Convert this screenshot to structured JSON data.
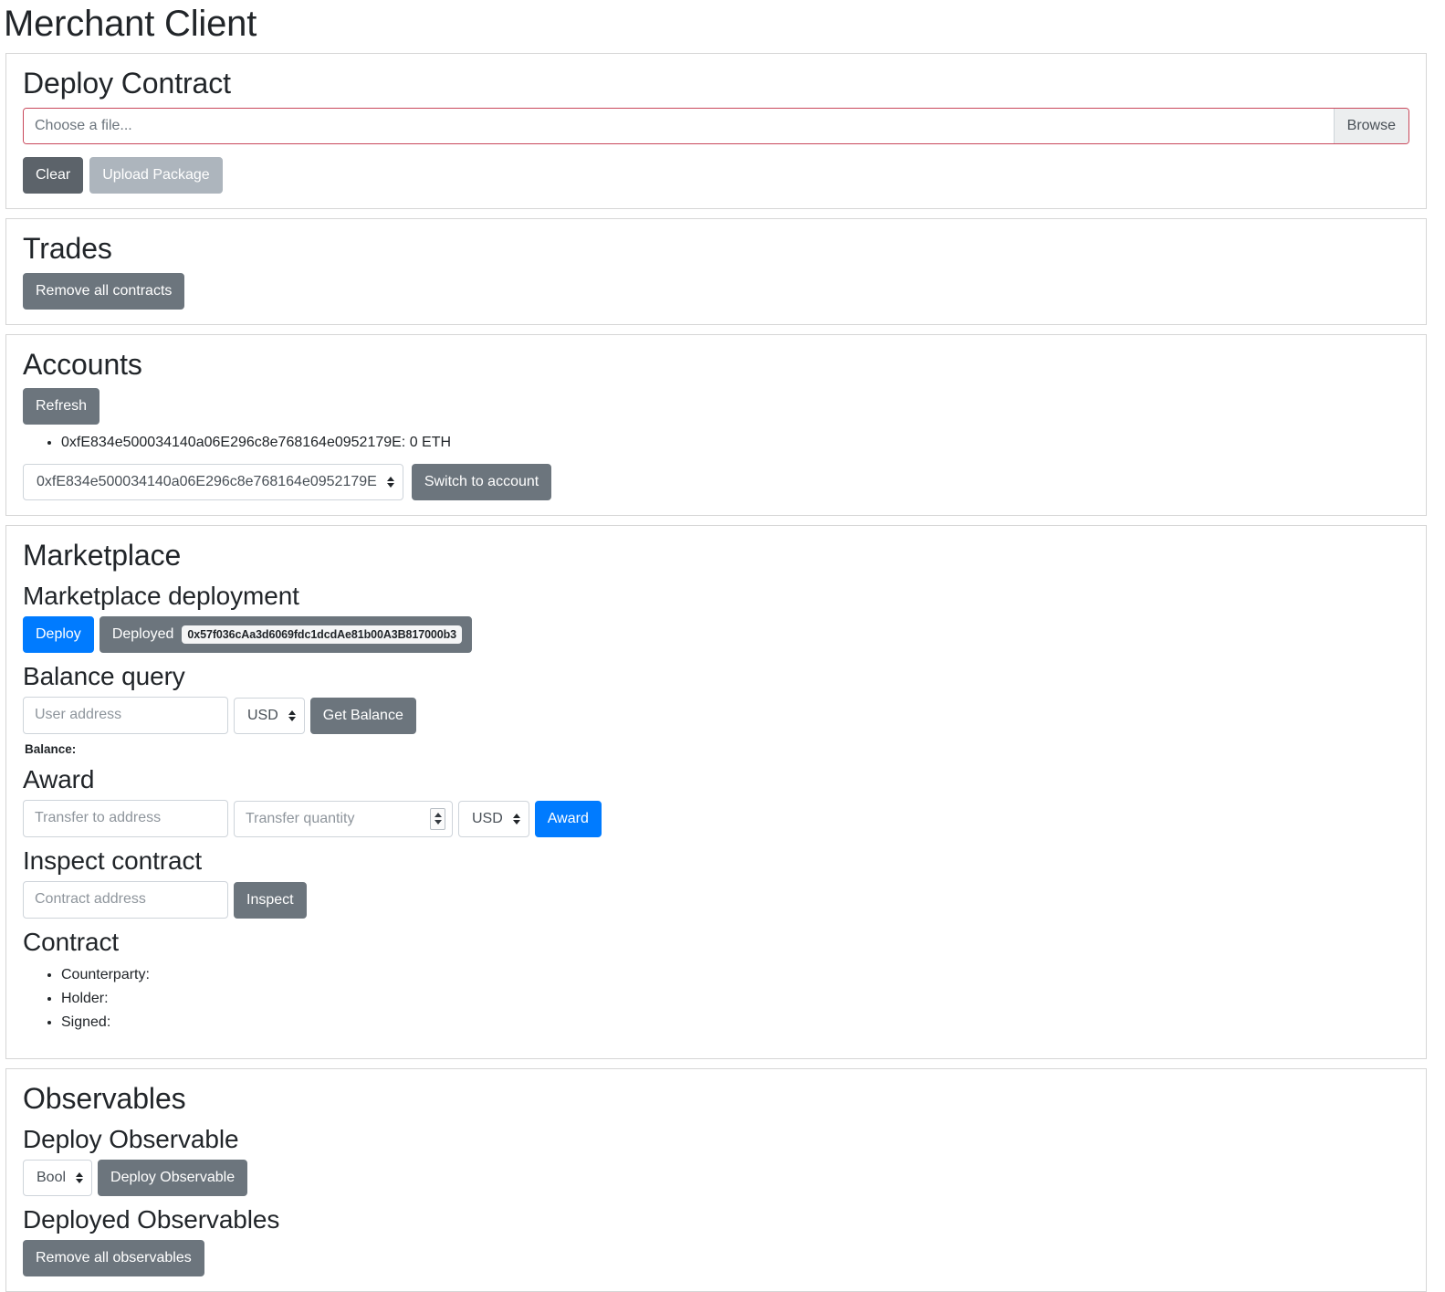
{
  "app": {
    "title": "Merchant Client"
  },
  "deploy_contract": {
    "heading": "Deploy Contract",
    "file_input": {
      "placeholder": "Choose a file...",
      "browse_label": "Browse",
      "border_color": "#c9485b"
    },
    "clear_label": "Clear",
    "upload_label": "Upload Package"
  },
  "trades": {
    "heading": "Trades",
    "remove_all_label": "Remove all contracts"
  },
  "accounts": {
    "heading": "Accounts",
    "refresh_label": "Refresh",
    "items": [
      "0xfE834e500034140a06E296c8e768164e0952179E: 0 ETH"
    ],
    "account_select": {
      "selected": "0xfE834e500034140a06E296c8e768164e0952179E",
      "options": [
        "0xfE834e500034140a06E296c8e768164e0952179E"
      ]
    },
    "switch_label": "Switch to account"
  },
  "marketplace": {
    "heading": "Marketplace",
    "deployment": {
      "heading": "Marketplace deployment",
      "deploy_label": "Deploy",
      "deployed_label": "Deployed",
      "deployed_address": "0x57f036cAa3d6069fdc1dcdAe81b00A3B817000b3",
      "deploy_color": "#007bff"
    },
    "balance_query": {
      "heading": "Balance query",
      "address_placeholder": "User address",
      "currency": {
        "selected": "USD",
        "options": [
          "USD"
        ]
      },
      "get_balance_label": "Get Balance",
      "balance_label": "Balance:"
    },
    "award": {
      "heading": "Award",
      "to_placeholder": "Transfer to address",
      "quantity_placeholder": "Transfer quantity",
      "currency": {
        "selected": "USD",
        "options": [
          "USD"
        ]
      },
      "award_label": "Award",
      "award_color": "#007bff"
    },
    "inspect": {
      "heading": "Inspect contract",
      "address_placeholder": "Contract address",
      "inspect_label": "Inspect"
    },
    "contract": {
      "heading": "Contract",
      "fields": [
        "Counterparty:",
        "Holder:",
        "Signed:"
      ]
    }
  },
  "observables": {
    "heading": "Observables",
    "deploy": {
      "heading": "Deploy Observable",
      "type_select": {
        "selected": "Bool",
        "options": [
          "Bool"
        ]
      },
      "deploy_label": "Deploy Observable"
    },
    "deployed": {
      "heading": "Deployed Observables",
      "remove_all_label": "Remove all observables"
    }
  }
}
